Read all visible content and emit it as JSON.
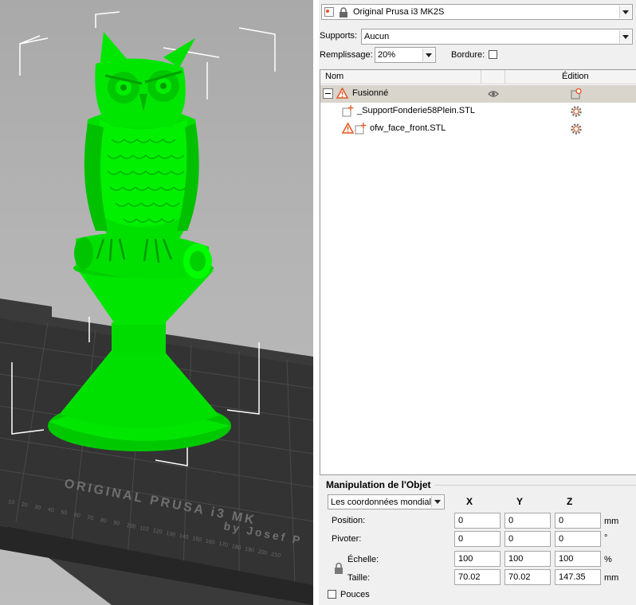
{
  "printer": {
    "name": "Original Prusa i3 MK2S"
  },
  "supports": {
    "label": "Supports:",
    "value": "Aucun"
  },
  "infill": {
    "label": "Remplissage:",
    "value": "20%"
  },
  "brim": {
    "label": "Bordure:",
    "checked": false
  },
  "object_list": {
    "col_name": "Nom",
    "col_edit": "Édition",
    "items": [
      {
        "name": "Fusionné",
        "warning": true,
        "selected": true
      },
      {
        "name": "_SupportFonderie58Plein.STL",
        "warning": false
      },
      {
        "name": "ofw_face_front.STL",
        "warning": true
      }
    ]
  },
  "manipulation": {
    "title": "Manipulation de l'Objet",
    "coord_system": "Les coordonnées mondiales",
    "axes": [
      "X",
      "Y",
      "Z"
    ],
    "rows": [
      {
        "label": "Position:",
        "values": [
          "0",
          "0",
          "0"
        ],
        "unit": "mm"
      },
      {
        "label": "Pivoter:",
        "values": [
          "0",
          "0",
          "0"
        ],
        "unit": "°"
      },
      {
        "label": "Échelle:",
        "values": [
          "100",
          "100",
          "100"
        ],
        "unit": "%"
      },
      {
        "label": "Taille:",
        "values": [
          "70.02",
          "70.02",
          "147.35"
        ],
        "unit": "mm"
      }
    ],
    "inches_label": "Pouces",
    "inches_checked": false
  },
  "viewport": {
    "bed_label_1": "ORIGINAL PRUSA i3 MK",
    "bed_label_2": "by Josef P",
    "model_color": "#00e600",
    "ruler_numbers": [
      "10",
      "20",
      "30",
      "40",
      "50",
      "60",
      "70",
      "80",
      "90",
      "100",
      "110",
      "120",
      "130",
      "140",
      "150",
      "160",
      "170",
      "180",
      "190",
      "200",
      "210"
    ]
  }
}
